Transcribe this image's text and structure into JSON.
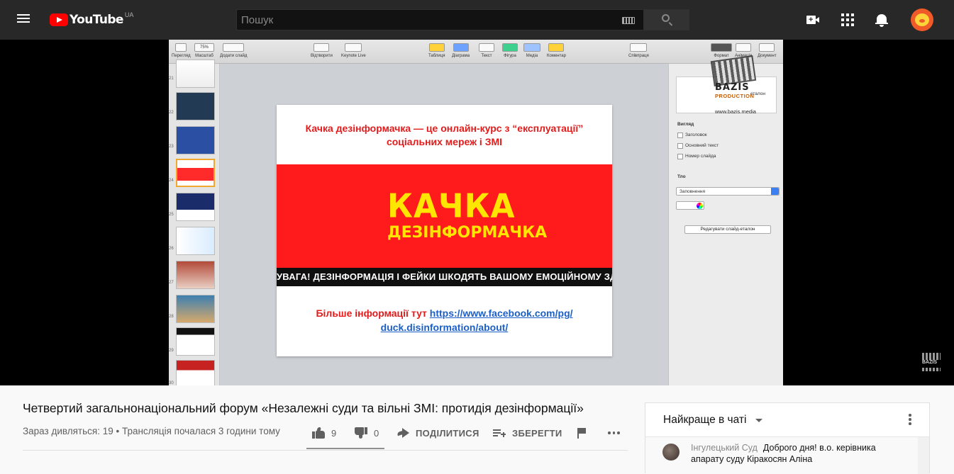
{
  "header": {
    "logo_text": "YouTube",
    "country_code": "UA",
    "search_placeholder": "Пошук"
  },
  "video": {
    "title": "Четвертий загальнонаціональний форум «Незалежні суди та вільні ЗМІ: протидія дезінформації»",
    "meta": "Зараз дивляться: 19 • Трансляція почалася 3 години тому",
    "likes": "9",
    "dislikes": "0",
    "share_label": "ПОДІЛИТИСЯ",
    "save_label": "ЗБЕРЕГТИ"
  },
  "keynote": {
    "toolbar": [
      {
        "label": "Перегляд"
      },
      {
        "label": "Масштаб",
        "value": "75%"
      },
      {
        "label": "Додати слайд"
      },
      {
        "label": "Відтворити"
      },
      {
        "label": "Keynote Live"
      },
      {
        "label": "Таблиця"
      },
      {
        "label": "Діаграма"
      },
      {
        "label": "Текст"
      },
      {
        "label": "Фігура"
      },
      {
        "label": "Медіа"
      },
      {
        "label": "Коментар"
      },
      {
        "label": "Співпраця"
      },
      {
        "label": "Формат"
      },
      {
        "label": "Анімація"
      },
      {
        "label": "Документ"
      }
    ],
    "slide_numbers": [
      "21",
      "22",
      "23",
      "24",
      "25",
      "26",
      "27",
      "28",
      "29",
      "30"
    ],
    "slide": {
      "heading": "Качка дезінформачка — це онлайн-курс з “експлуатації” соціальних мереж і ЗМІ",
      "banner_title": "КАЧКА",
      "banner_subtitle": "ДЕЗІНФОРМАЧКА",
      "banner_strip": "УВАГА! ДЕЗІНФОРМАЦІЯ І ФЕЙКИ ШКОДЯТЬ ВАШОМУ ЕМОЦІЙНОМУ ЗДОРОВ'Ю",
      "more_text": "Більше інформації тут",
      "link_line1": "https://www.facebook.com/pg/",
      "link_line2": "duck.disinformation/about/"
    },
    "inspector": {
      "card_text": "еталон",
      "view_label": "Вигляд",
      "checkboxes": [
        "Заголовок",
        "Основний текст",
        "Номер слайда"
      ],
      "background_label": "Тло",
      "fill_value": "Заповнення",
      "edit_master_button": "Редагувати слайд-еталон"
    },
    "watermark": {
      "brand": "BAZIS",
      "production": "PRODUCTION",
      "url": "www.bazis.media"
    }
  },
  "corner_logo_text": "BAZIS",
  "chat": {
    "title": "Найкраще в чаті",
    "messages": [
      {
        "author": "Інгулецький Суд",
        "text": "Доброго дня! в.о. керівника апарату суду Кіракосян Аліна"
      }
    ]
  },
  "colors": {
    "topbar": "#282828",
    "youtube_red": "#ff0000",
    "slide_red": "#ff1b1b",
    "slide_yellow": "#ffe600",
    "link_blue": "#1b5fc7"
  }
}
